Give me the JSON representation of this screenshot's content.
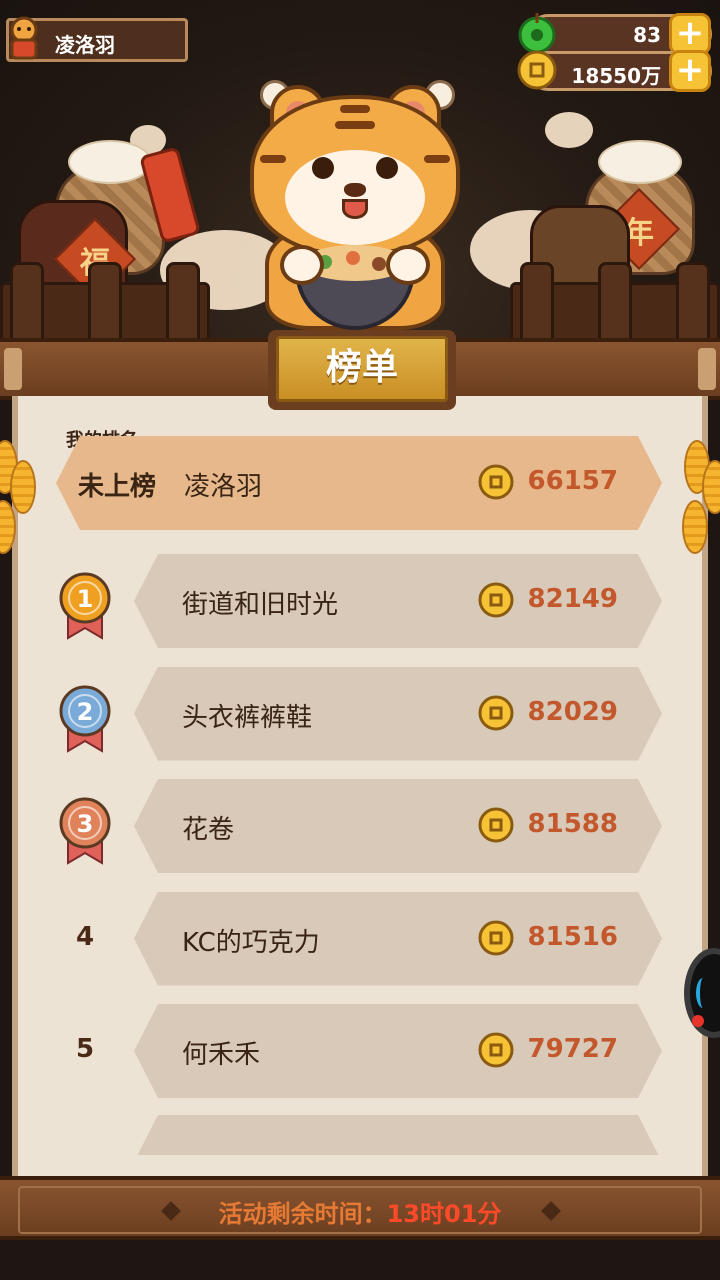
{
  "header": {
    "player_name": "凌洛羽",
    "jade_count": "83",
    "coin_count": "18550万",
    "plus_glyph": "+"
  },
  "scene": {
    "jar_char": "福",
    "basket_char": "年"
  },
  "board": {
    "title": "榜单",
    "my_rank_label": "我的排名",
    "my_row": {
      "status": "未上榜",
      "name": "凌洛羽",
      "score": "66157"
    },
    "rows": [
      {
        "rank": "1",
        "name": "街道和旧时光",
        "score": "82149"
      },
      {
        "rank": "2",
        "name": "头衣裤裤鞋",
        "score": "82029"
      },
      {
        "rank": "3",
        "name": "花卷",
        "score": "81588"
      },
      {
        "rank": "4",
        "name": "KC的巧克力",
        "score": "81516"
      },
      {
        "rank": "5",
        "name": "何禾禾",
        "score": "79727"
      }
    ]
  },
  "footer": {
    "remaining_label": "活动剩余时间：",
    "remaining_time": "13时01分"
  },
  "colors": {
    "gold": "#e0b44a",
    "wood": "#6b3e20",
    "score": "#c2582c",
    "medal_gold": "#f0a020",
    "medal_silver": "#7aaad8",
    "medal_bronze": "#e0835a",
    "timer": "#ff4a2a"
  },
  "icons": {
    "jade": "jade-coin-icon",
    "coin": "copper-coin-icon",
    "plus": "plus-icon",
    "medal": "rank-medal-icon"
  }
}
